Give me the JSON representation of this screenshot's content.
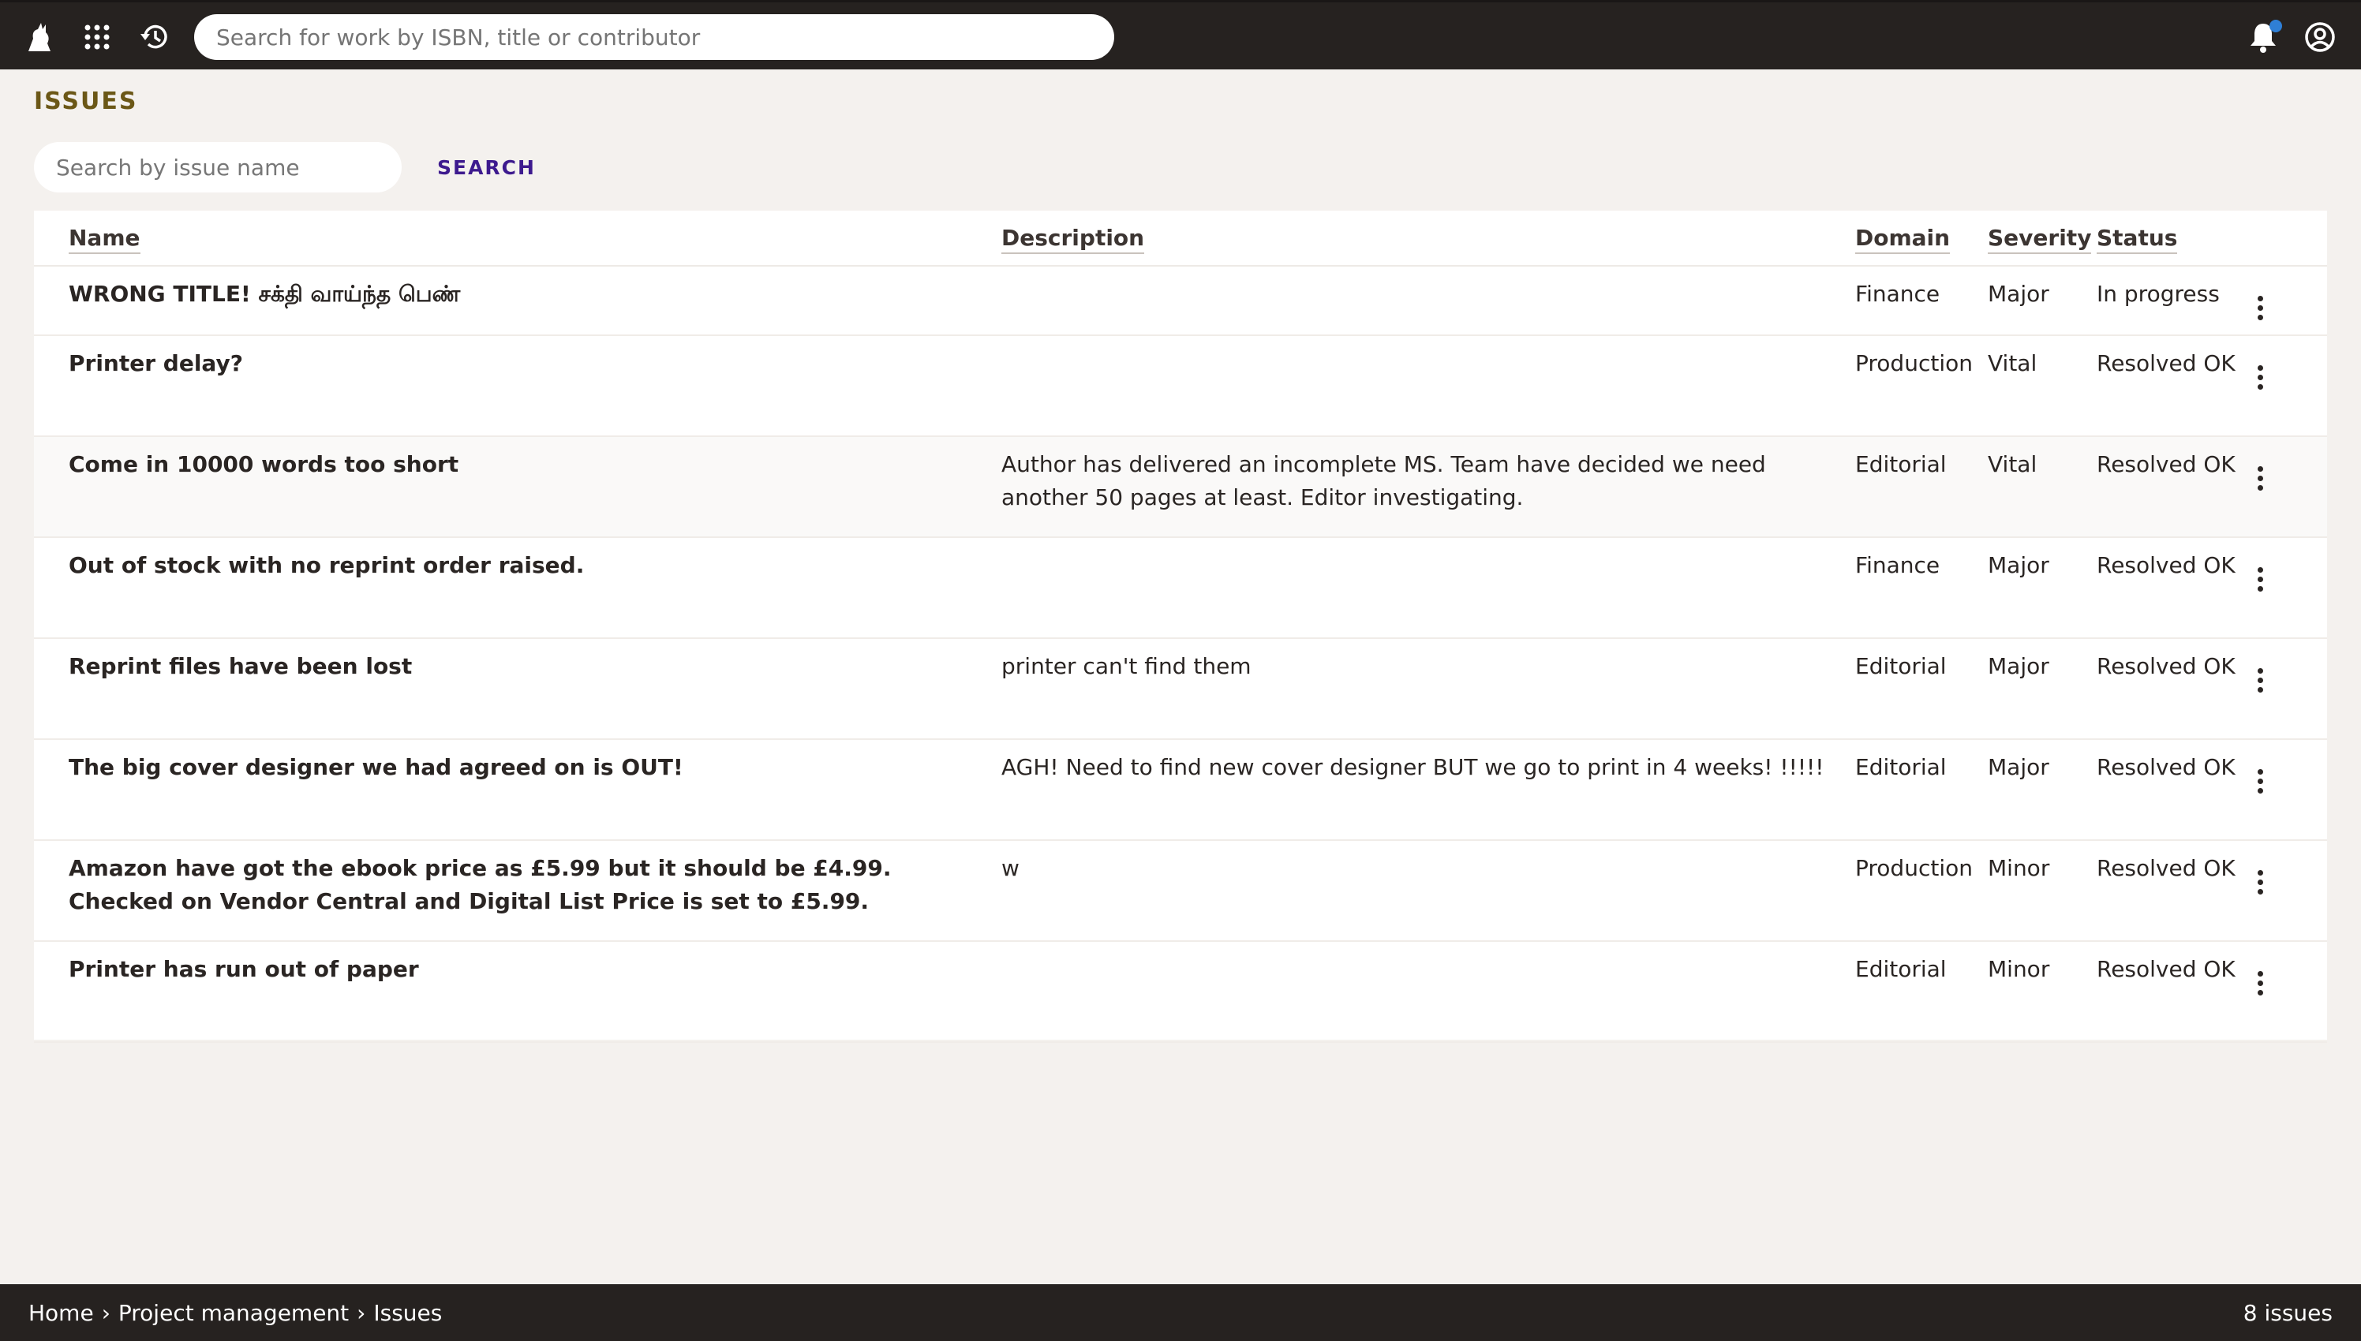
{
  "topbar": {
    "search_placeholder": "Search for work by ISBN, title or contributor",
    "icons": [
      "cat-logo-icon",
      "apps-grid-icon",
      "history-icon",
      "notifications-bell-icon",
      "account-circle-icon"
    ],
    "notification_dot_color": "#2f7fd6"
  },
  "page": {
    "title": "ISSUES",
    "search_placeholder": "Search by issue name",
    "search_button": "SEARCH"
  },
  "table": {
    "headers": {
      "name": "Name",
      "description": "Description",
      "domain": "Domain",
      "severity": "Severity",
      "status": "Status"
    },
    "rows": [
      {
        "name": "WRONG TITLE! சக்தி வாய்ந்த பெண்",
        "description": "",
        "domain": "Finance",
        "severity": "Major",
        "status": "In progress"
      },
      {
        "name": "Printer delay?",
        "description": "",
        "domain": "Production",
        "severity": "Vital",
        "status": "Resolved OK"
      },
      {
        "name": "Come in 10000 words too short",
        "description": "Author has delivered an incomplete MS. Team have decided we need another 50 pages at least. Editor investigating.",
        "domain": "Editorial",
        "severity": "Vital",
        "status": "Resolved OK"
      },
      {
        "name": "Out of stock with no reprint order raised.",
        "description": "",
        "domain": "Finance",
        "severity": "Major",
        "status": "Resolved OK"
      },
      {
        "name": "Reprint files have been lost",
        "description": "printer can't find them",
        "domain": "Editorial",
        "severity": "Major",
        "status": "Resolved OK"
      },
      {
        "name": "The big cover designer we had agreed on is OUT!",
        "description": "AGH! Need to find new cover designer BUT we go to print in 4 weeks! !!!!!",
        "domain": "Editorial",
        "severity": "Major",
        "status": "Resolved OK"
      },
      {
        "name": "Amazon have got the ebook price as £5.99 but it should be £4.99. Checked on Vendor Central and Digital List Price is set to £5.99.",
        "description": "w",
        "domain": "Production",
        "severity": "Minor",
        "status": "Resolved OK"
      },
      {
        "name": "Printer has run out of paper",
        "description": "",
        "domain": "Editorial",
        "severity": "Minor",
        "status": "Resolved OK"
      }
    ]
  },
  "footer": {
    "breadcrumb": [
      "Home",
      "Project management",
      "Issues"
    ],
    "separator": "›",
    "count": "8 issues"
  },
  "colors": {
    "topbar_bg": "#262220",
    "page_bg": "#f4f1ee",
    "title": "#6b5716",
    "search_button": "#3d1a8e"
  }
}
